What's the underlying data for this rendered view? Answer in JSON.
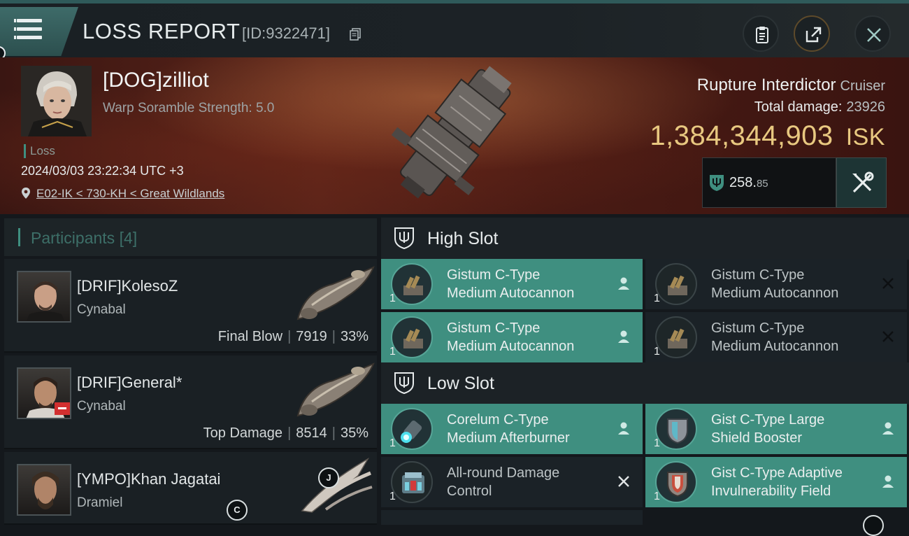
{
  "header": {
    "title": "LOSS REPORT",
    "id_label": "[ID:9322471]"
  },
  "victim": {
    "name": "[DOG]zilliot",
    "warp_scramble": "Warp Soramble Strength: 5.0",
    "tag": "Loss",
    "datetime": "2024/03/03 23:22:34 UTC +3",
    "location": "E02-IK < 730-KH < Great Wildlands"
  },
  "ship": {
    "name": "Rupture Interdictor",
    "class": "Cruiser",
    "total_damage_label": "Total damage:",
    "total_damage": "23926",
    "isk_value": "1,384,344,903",
    "isk_unit": "ISK",
    "security_main": "258.",
    "security_decimal": "85"
  },
  "participants": {
    "label": "Participants",
    "count": "[4]",
    "list": [
      {
        "name": "[DRIF]KolesoZ",
        "ship": "Cynabal",
        "role": "Final Blow",
        "damage": "7919",
        "percent": "33%"
      },
      {
        "name": "[DRIF]General*",
        "ship": "Cynabal",
        "role": "Top Damage",
        "damage": "8514",
        "percent": "35%"
      },
      {
        "name": "[YMPO]Khan Jagatai",
        "ship": "Dramiel"
      }
    ],
    "badge_j": "J",
    "badge_c": "C"
  },
  "slots": {
    "high": {
      "label": "High Slot",
      "modules": [
        {
          "qty": "1",
          "line1": "Gistum C-Type",
          "line2": "Medium Autocannon",
          "state": "active"
        },
        {
          "qty": "1",
          "line1": "Gistum C-Type",
          "line2": "Medium Autocannon",
          "state": "inactive"
        },
        {
          "qty": "1",
          "line1": "Gistum C-Type",
          "line2": "Medium Autocannon",
          "state": "active"
        },
        {
          "qty": "1",
          "line1": "Gistum C-Type",
          "line2": "Medium Autocannon",
          "state": "inactive"
        }
      ]
    },
    "low": {
      "label": "Low Slot",
      "modules": [
        {
          "qty": "1",
          "line1": "Corelum C-Type",
          "line2": "Medium Afterburner",
          "state": "active"
        },
        {
          "qty": "1",
          "line1": "Gist C-Type Large",
          "line2": "Shield Booster",
          "state": "active"
        },
        {
          "qty": "1",
          "line1": "All-round Damage",
          "line2": "Control",
          "state": "inactive"
        },
        {
          "qty": "1",
          "line1": "Gist C-Type Adaptive",
          "line2": "Invulnerability Field",
          "state": "active"
        }
      ]
    }
  },
  "colors": {
    "accent": "#3f8f80",
    "isk_gold": "#e8c880",
    "banner_red": "#5b2419"
  }
}
